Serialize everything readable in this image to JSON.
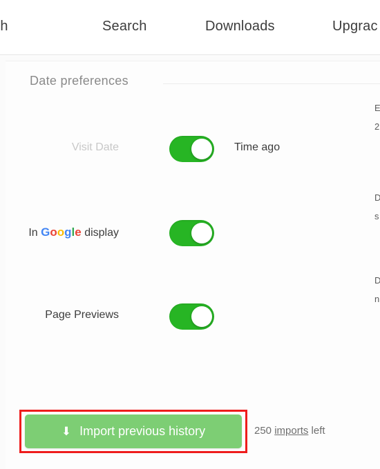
{
  "nav": {
    "items": [
      {
        "label": "arch",
        "name": "nav-item-search-partial"
      },
      {
        "label": "Search",
        "name": "nav-item-search"
      },
      {
        "label": "Downloads",
        "name": "nav-item-downloads"
      },
      {
        "label": "Upgrac",
        "name": "nav-item-upgrade"
      }
    ]
  },
  "section": {
    "title": "Date preferences"
  },
  "rows": [
    {
      "left_label": "Visit Date",
      "right_label": "Time ago",
      "toggle_state": "on",
      "toggle_name": "visit-date-toggle"
    },
    {
      "left_label_prefix": "In ",
      "left_label_brand": "Google",
      "left_label_suffix": " display",
      "right_label": "",
      "toggle_state": "on",
      "toggle_name": "in-google-display-toggle"
    },
    {
      "left_label": "Page Previews",
      "right_label": "",
      "toggle_state": "on",
      "toggle_name": "page-previews-toggle"
    }
  ],
  "right_column": [
    {
      "text": "E"
    },
    {
      "text": "2"
    },
    {
      "text": "D"
    },
    {
      "text": "s"
    },
    {
      "text": "D"
    },
    {
      "text": "n"
    }
  ],
  "import": {
    "icon": "download-arrow-icon",
    "button_label": "Import previous history",
    "count": "250",
    "link_text": "imports",
    "suffix_text": " left"
  },
  "colors": {
    "toggle_on": "#27b524",
    "button_green": "#7dce74",
    "highlight_red": "#ee1c1c",
    "google_blue": "#4285f4",
    "google_red": "#ea4335",
    "google_yellow": "#fbbc05",
    "google_green": "#34a853"
  }
}
